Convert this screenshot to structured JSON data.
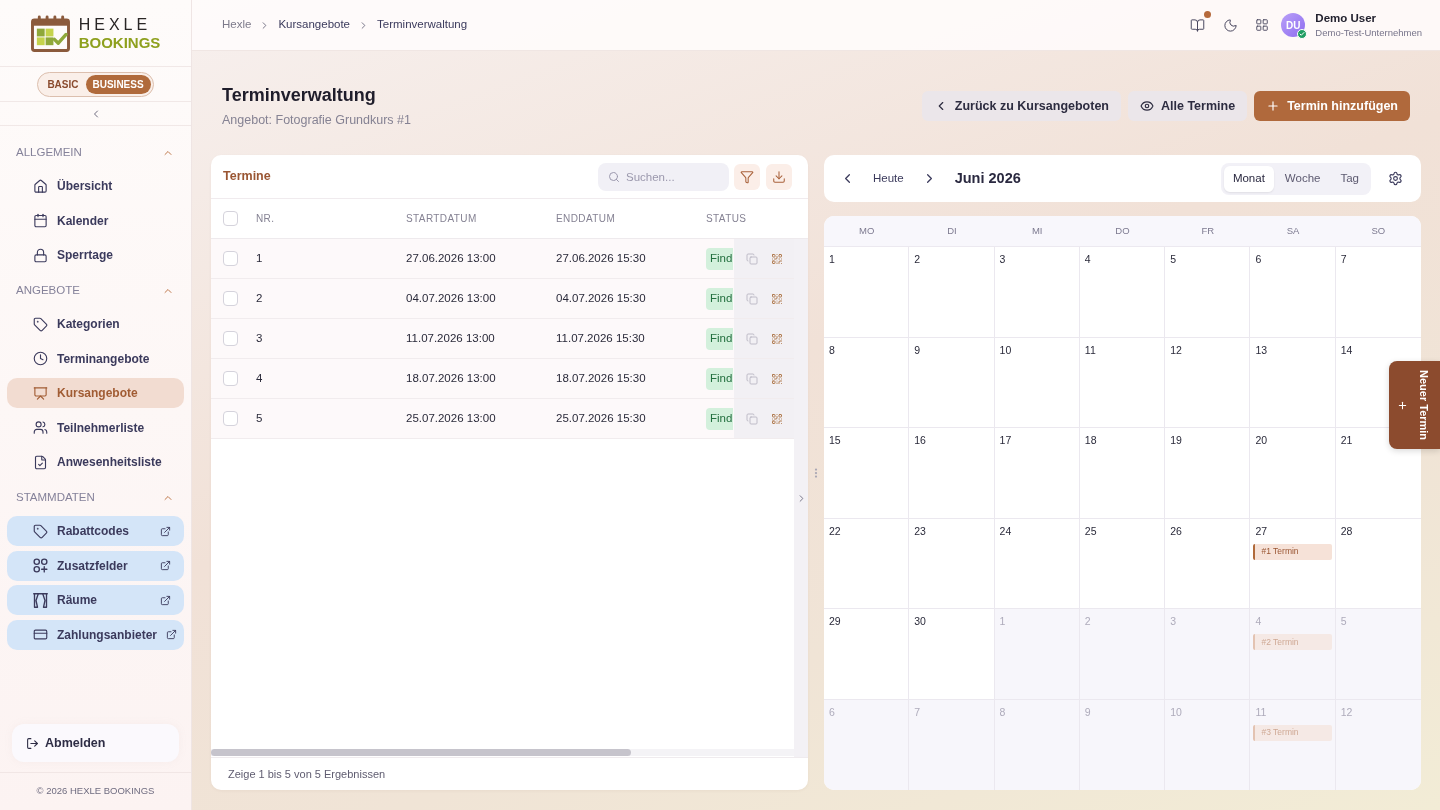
{
  "sidebar": {
    "logo": {
      "line_1": "HEXLE",
      "line_2": "BOOKINGS"
    },
    "plans": [
      {
        "label": "BASIC",
        "selected": false
      },
      {
        "label": "BUSINESS",
        "selected": true
      }
    ],
    "sections": [
      {
        "title": "ALLGEMEIN",
        "expanded": true,
        "items": [
          {
            "label": "Übersicht",
            "selected": false,
            "external": false
          },
          {
            "label": "Kalender",
            "selected": false,
            "external": false
          },
          {
            "label": "Sperrtage",
            "selected": false,
            "external": false
          }
        ]
      },
      {
        "title": "ANGEBOTE",
        "expanded": true,
        "items": [
          {
            "label": "Kategorien",
            "selected": false,
            "external": false
          },
          {
            "label": "Terminangebote",
            "selected": false,
            "external": false
          },
          {
            "label": "Kursangebote",
            "selected": true,
            "external": false
          },
          {
            "label": "Teilnehmerliste",
            "selected": false,
            "external": false
          },
          {
            "label": "Anwesenheitsliste",
            "selected": false,
            "external": false
          }
        ]
      },
      {
        "title": "STAMMDATEN",
        "expanded": true,
        "items": [
          {
            "label": "Rabattcodes",
            "selected": false,
            "external": true
          },
          {
            "label": "Zusatzfelder",
            "selected": false,
            "external": true
          },
          {
            "label": "Räume",
            "selected": false,
            "external": true
          },
          {
            "label": "Zahlungsanbieter",
            "selected": false,
            "external": true
          }
        ]
      }
    ],
    "logout": "Abmelden",
    "copyright": "© 2026 HEXLE BOOKINGS"
  },
  "header": {
    "breadcrumb": [
      {
        "label": "Hexle"
      },
      {
        "label": "Kursangebote"
      },
      {
        "label": "Terminverwaltung"
      }
    ],
    "guide_unread": true,
    "user": {
      "initials": "DU",
      "online": true,
      "name": "Demo User",
      "company": "Demo-Test-Unternehmen"
    }
  },
  "page": {
    "title": "Terminverwaltung",
    "subtitle": "Angebot: Fotografie Grundkurs #1",
    "actions": [
      {
        "label": "Zurück zu Kursangeboten",
        "kind": "back"
      },
      {
        "label": "Alle Termine",
        "kind": "view"
      },
      {
        "label": "Termin hinzufügen",
        "kind": "add"
      }
    ]
  },
  "appointments": {
    "title": "Termine",
    "search": {
      "placeholder": "Suchen..."
    },
    "select_all": false,
    "columns": [
      "NR.",
      "STARTDATUM",
      "ENDDATUM",
      "STATUS"
    ],
    "rows": [
      {
        "nr": "1",
        "start": "27.06.2026 13:00",
        "end": "27.06.2026 15:30",
        "status": "Find",
        "checked": false
      },
      {
        "nr": "2",
        "start": "04.07.2026 13:00",
        "end": "04.07.2026 15:30",
        "status": "Find",
        "checked": false
      },
      {
        "nr": "3",
        "start": "11.07.2026 13:00",
        "end": "11.07.2026 15:30",
        "status": "Find",
        "checked": false
      },
      {
        "nr": "4",
        "start": "18.07.2026 13:00",
        "end": "18.07.2026 15:30",
        "status": "Find",
        "checked": false
      },
      {
        "nr": "5",
        "start": "25.07.2026 13:00",
        "end": "25.07.2026 15:30",
        "status": "Find",
        "checked": false
      }
    ],
    "footer": "Zeige 1 bis 5 von 5 Ergebnissen"
  },
  "calendar": {
    "today": "Heute",
    "month": "Juni 2026",
    "views": [
      {
        "label": "Monat",
        "selected": true
      },
      {
        "label": "Woche",
        "selected": false
      },
      {
        "label": "Tag",
        "selected": false
      }
    ],
    "weekdays": [
      "MO",
      "DI",
      "MI",
      "DO",
      "FR",
      "SA",
      "SO"
    ],
    "weeks": [
      [
        {
          "day": "1",
          "in_month": true
        },
        {
          "day": "2",
          "in_month": true
        },
        {
          "day": "3",
          "in_month": true
        },
        {
          "day": "4",
          "in_month": true
        },
        {
          "day": "5",
          "in_month": true
        },
        {
          "day": "6",
          "in_month": true
        },
        {
          "day": "7",
          "in_month": true
        }
      ],
      [
        {
          "day": "8",
          "in_month": true
        },
        {
          "day": "9",
          "in_month": true
        },
        {
          "day": "10",
          "in_month": true
        },
        {
          "day": "11",
          "in_month": true
        },
        {
          "day": "12",
          "in_month": true
        },
        {
          "day": "13",
          "in_month": true
        },
        {
          "day": "14",
          "in_month": true
        }
      ],
      [
        {
          "day": "15",
          "in_month": true
        },
        {
          "day": "16",
          "in_month": true
        },
        {
          "day": "17",
          "in_month": true
        },
        {
          "day": "18",
          "in_month": true
        },
        {
          "day": "19",
          "in_month": true
        },
        {
          "day": "20",
          "in_month": true
        },
        {
          "day": "21",
          "in_month": true
        }
      ],
      [
        {
          "day": "22",
          "in_month": true
        },
        {
          "day": "23",
          "in_month": true
        },
        {
          "day": "24",
          "in_month": true
        },
        {
          "day": "25",
          "in_month": true
        },
        {
          "day": "26",
          "in_month": true
        },
        {
          "day": "27",
          "in_month": true,
          "events": [
            {
              "label": "#1 Termin"
            }
          ]
        },
        {
          "day": "28",
          "in_month": true
        }
      ],
      [
        {
          "day": "29",
          "in_month": true
        },
        {
          "day": "30",
          "in_month": true
        },
        {
          "day": "1",
          "in_month": false
        },
        {
          "day": "2",
          "in_month": false
        },
        {
          "day": "3",
          "in_month": false
        },
        {
          "day": "4",
          "in_month": false,
          "events": [
            {
              "label": "#2 Termin"
            }
          ]
        },
        {
          "day": "5",
          "in_month": false
        }
      ],
      [
        {
          "day": "6",
          "in_month": false
        },
        {
          "day": "7",
          "in_month": false
        },
        {
          "day": "8",
          "in_month": false
        },
        {
          "day": "9",
          "in_month": false
        },
        {
          "day": "10",
          "in_month": false
        },
        {
          "day": "11",
          "in_month": false,
          "events": [
            {
              "label": "#3 Termin"
            }
          ]
        },
        {
          "day": "12",
          "in_month": false
        }
      ]
    ]
  },
  "new_appointment_tab": {
    "label": "Neuer Termin"
  }
}
